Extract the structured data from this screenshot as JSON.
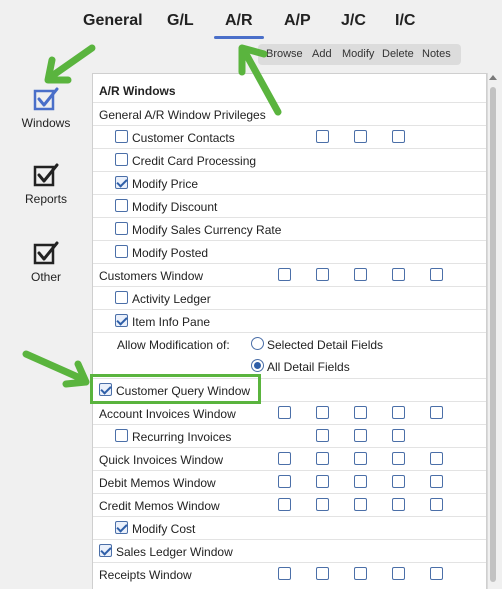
{
  "tabs": [
    {
      "label": "General",
      "active": false
    },
    {
      "label": "G/L",
      "active": false
    },
    {
      "label": "A/R",
      "active": true
    },
    {
      "label": "A/P",
      "active": false
    },
    {
      "label": "J/C",
      "active": false
    },
    {
      "label": "I/C",
      "active": false
    }
  ],
  "columns": [
    "Browse",
    "Add",
    "Modify",
    "Delete",
    "Notes"
  ],
  "sidebar": [
    {
      "label": "Windows",
      "selected": true
    },
    {
      "label": "Reports",
      "selected": false
    },
    {
      "label": "Other",
      "selected": false
    }
  ],
  "panel": {
    "section_title": "A/R Windows",
    "general_privileges": "General A/R Window Privileges",
    "rows": [
      {
        "label": "Customer Contacts",
        "checked": false
      },
      {
        "label": "Credit Card Processing",
        "checked": false
      },
      {
        "label": "Modify Price",
        "checked": true
      },
      {
        "label": "Modify Discount",
        "checked": false
      },
      {
        "label": "Modify Sales Currency Rate",
        "checked": false
      },
      {
        "label": "Modify Posted",
        "checked": false
      },
      {
        "label": "Customers Window"
      },
      {
        "label": "Activity Ledger",
        "checked": false
      },
      {
        "label": "Item Info Pane",
        "checked": true
      },
      {
        "label": "Allow Modification of:"
      },
      {
        "label": "Customer Query Window",
        "checked": true
      },
      {
        "label": "Account Invoices Window"
      },
      {
        "label": "Recurring Invoices",
        "checked": false
      },
      {
        "label": "Quick Invoices Window"
      },
      {
        "label": "Debit Memos Window"
      },
      {
        "label": "Credit Memos Window"
      },
      {
        "label": "Modify Cost",
        "checked": true
      },
      {
        "label": "Sales Ledger Window",
        "checked": true
      },
      {
        "label": "Receipts Window"
      }
    ],
    "radio_options": [
      {
        "label": "Selected Detail Fields",
        "selected": false
      },
      {
        "label": "All Detail Fields",
        "selected": true
      }
    ]
  },
  "colors": {
    "accent": "#4a6fc9",
    "highlight": "#5ab43e",
    "arrow": "#5ab43e"
  }
}
